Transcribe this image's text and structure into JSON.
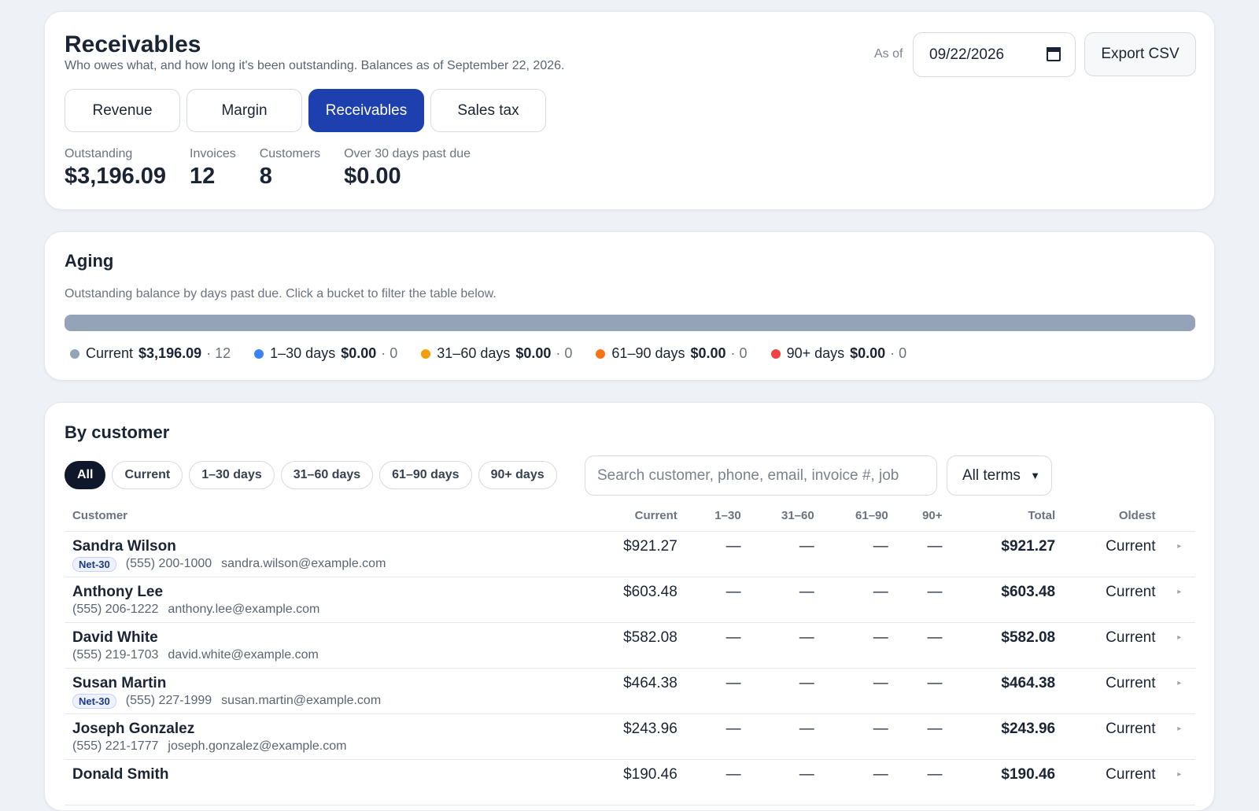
{
  "header": {
    "title": "Receivables",
    "subtitle": "Who owes what, and how long it's been outstanding. Balances as of September 22, 2026.",
    "as_of_label": "As of",
    "as_of_date": "09/22/2026",
    "export_label": "Export CSV"
  },
  "tabs": [
    {
      "label": "Revenue",
      "active": false
    },
    {
      "label": "Margin",
      "active": false
    },
    {
      "label": "Receivables",
      "active": true
    },
    {
      "label": "Sales tax",
      "active": false
    }
  ],
  "stats": [
    {
      "label": "Outstanding",
      "value": "$3,196.09"
    },
    {
      "label": "Invoices",
      "value": "12"
    },
    {
      "label": "Customers",
      "value": "8"
    },
    {
      "label": "Over 30 days past due",
      "value": "$0.00"
    }
  ],
  "aging": {
    "title": "Aging",
    "subtitle": "Outstanding balance by days past due. Click a bucket to filter the table below.",
    "buckets": [
      {
        "label": "Current",
        "amount": "$3,196.09",
        "count": "12",
        "share": 1.0,
        "color": "#94a3b8"
      },
      {
        "label": "1–30 days",
        "amount": "$0.00",
        "count": "0",
        "share": 0,
        "color": "#3b82f6"
      },
      {
        "label": "31–60 days",
        "amount": "$0.00",
        "count": "0",
        "share": 0,
        "color": "#f59e0b"
      },
      {
        "label": "61–90 days",
        "amount": "$0.00",
        "count": "0",
        "share": 0,
        "color": "#f97316"
      },
      {
        "label": "90+ days",
        "amount": "$0.00",
        "count": "0",
        "share": 0,
        "color": "#ef4444"
      }
    ]
  },
  "customers": {
    "title": "By customer",
    "filters": [
      {
        "label": "All",
        "active": true
      },
      {
        "label": "Current",
        "active": false
      },
      {
        "label": "1–30 days",
        "active": false
      },
      {
        "label": "31–60 days",
        "active": false
      },
      {
        "label": "61–90 days",
        "active": false
      },
      {
        "label": "90+ days",
        "active": false
      }
    ],
    "search_placeholder": "Search customer, phone, email, invoice #, job",
    "terms_select": "All terms",
    "columns": {
      "customer": "Customer",
      "current": "Current",
      "d1_30": "1–30",
      "d31_60": "31–60",
      "d61_90": "61–90",
      "d90": "90+",
      "total": "Total",
      "oldest": "Oldest"
    },
    "rows": [
      {
        "name": "Sandra Wilson",
        "terms": "Net-30",
        "phone": "(555) 200-1000",
        "email": "sandra.wilson@example.com",
        "current": "$921.27",
        "d1_30": "—",
        "d31_60": "—",
        "d61_90": "—",
        "d90": "—",
        "total": "$921.27",
        "oldest": "Current"
      },
      {
        "name": "Anthony Lee",
        "terms": "",
        "phone": "(555) 206-1222",
        "email": "anthony.lee@example.com",
        "current": "$603.48",
        "d1_30": "—",
        "d31_60": "—",
        "d61_90": "—",
        "d90": "—",
        "total": "$603.48",
        "oldest": "Current"
      },
      {
        "name": "David White",
        "terms": "",
        "phone": "(555) 219-1703",
        "email": "david.white@example.com",
        "current": "$582.08",
        "d1_30": "—",
        "d31_60": "—",
        "d61_90": "—",
        "d90": "—",
        "total": "$582.08",
        "oldest": "Current"
      },
      {
        "name": "Susan Martin",
        "terms": "Net-30",
        "phone": "(555) 227-1999",
        "email": "susan.martin@example.com",
        "current": "$464.38",
        "d1_30": "—",
        "d31_60": "—",
        "d61_90": "—",
        "d90": "—",
        "total": "$464.38",
        "oldest": "Current"
      },
      {
        "name": "Joseph Gonzalez",
        "terms": "",
        "phone": "(555) 221-1777",
        "email": "joseph.gonzalez@example.com",
        "current": "$243.96",
        "d1_30": "—",
        "d31_60": "—",
        "d61_90": "—",
        "d90": "—",
        "total": "$243.96",
        "oldest": "Current"
      },
      {
        "name": "Donald Smith",
        "terms": "",
        "phone": "",
        "email": "",
        "current": "$190.46",
        "d1_30": "—",
        "d31_60": "—",
        "d61_90": "—",
        "d90": "—",
        "total": "$190.46",
        "oldest": "Current"
      }
    ]
  }
}
